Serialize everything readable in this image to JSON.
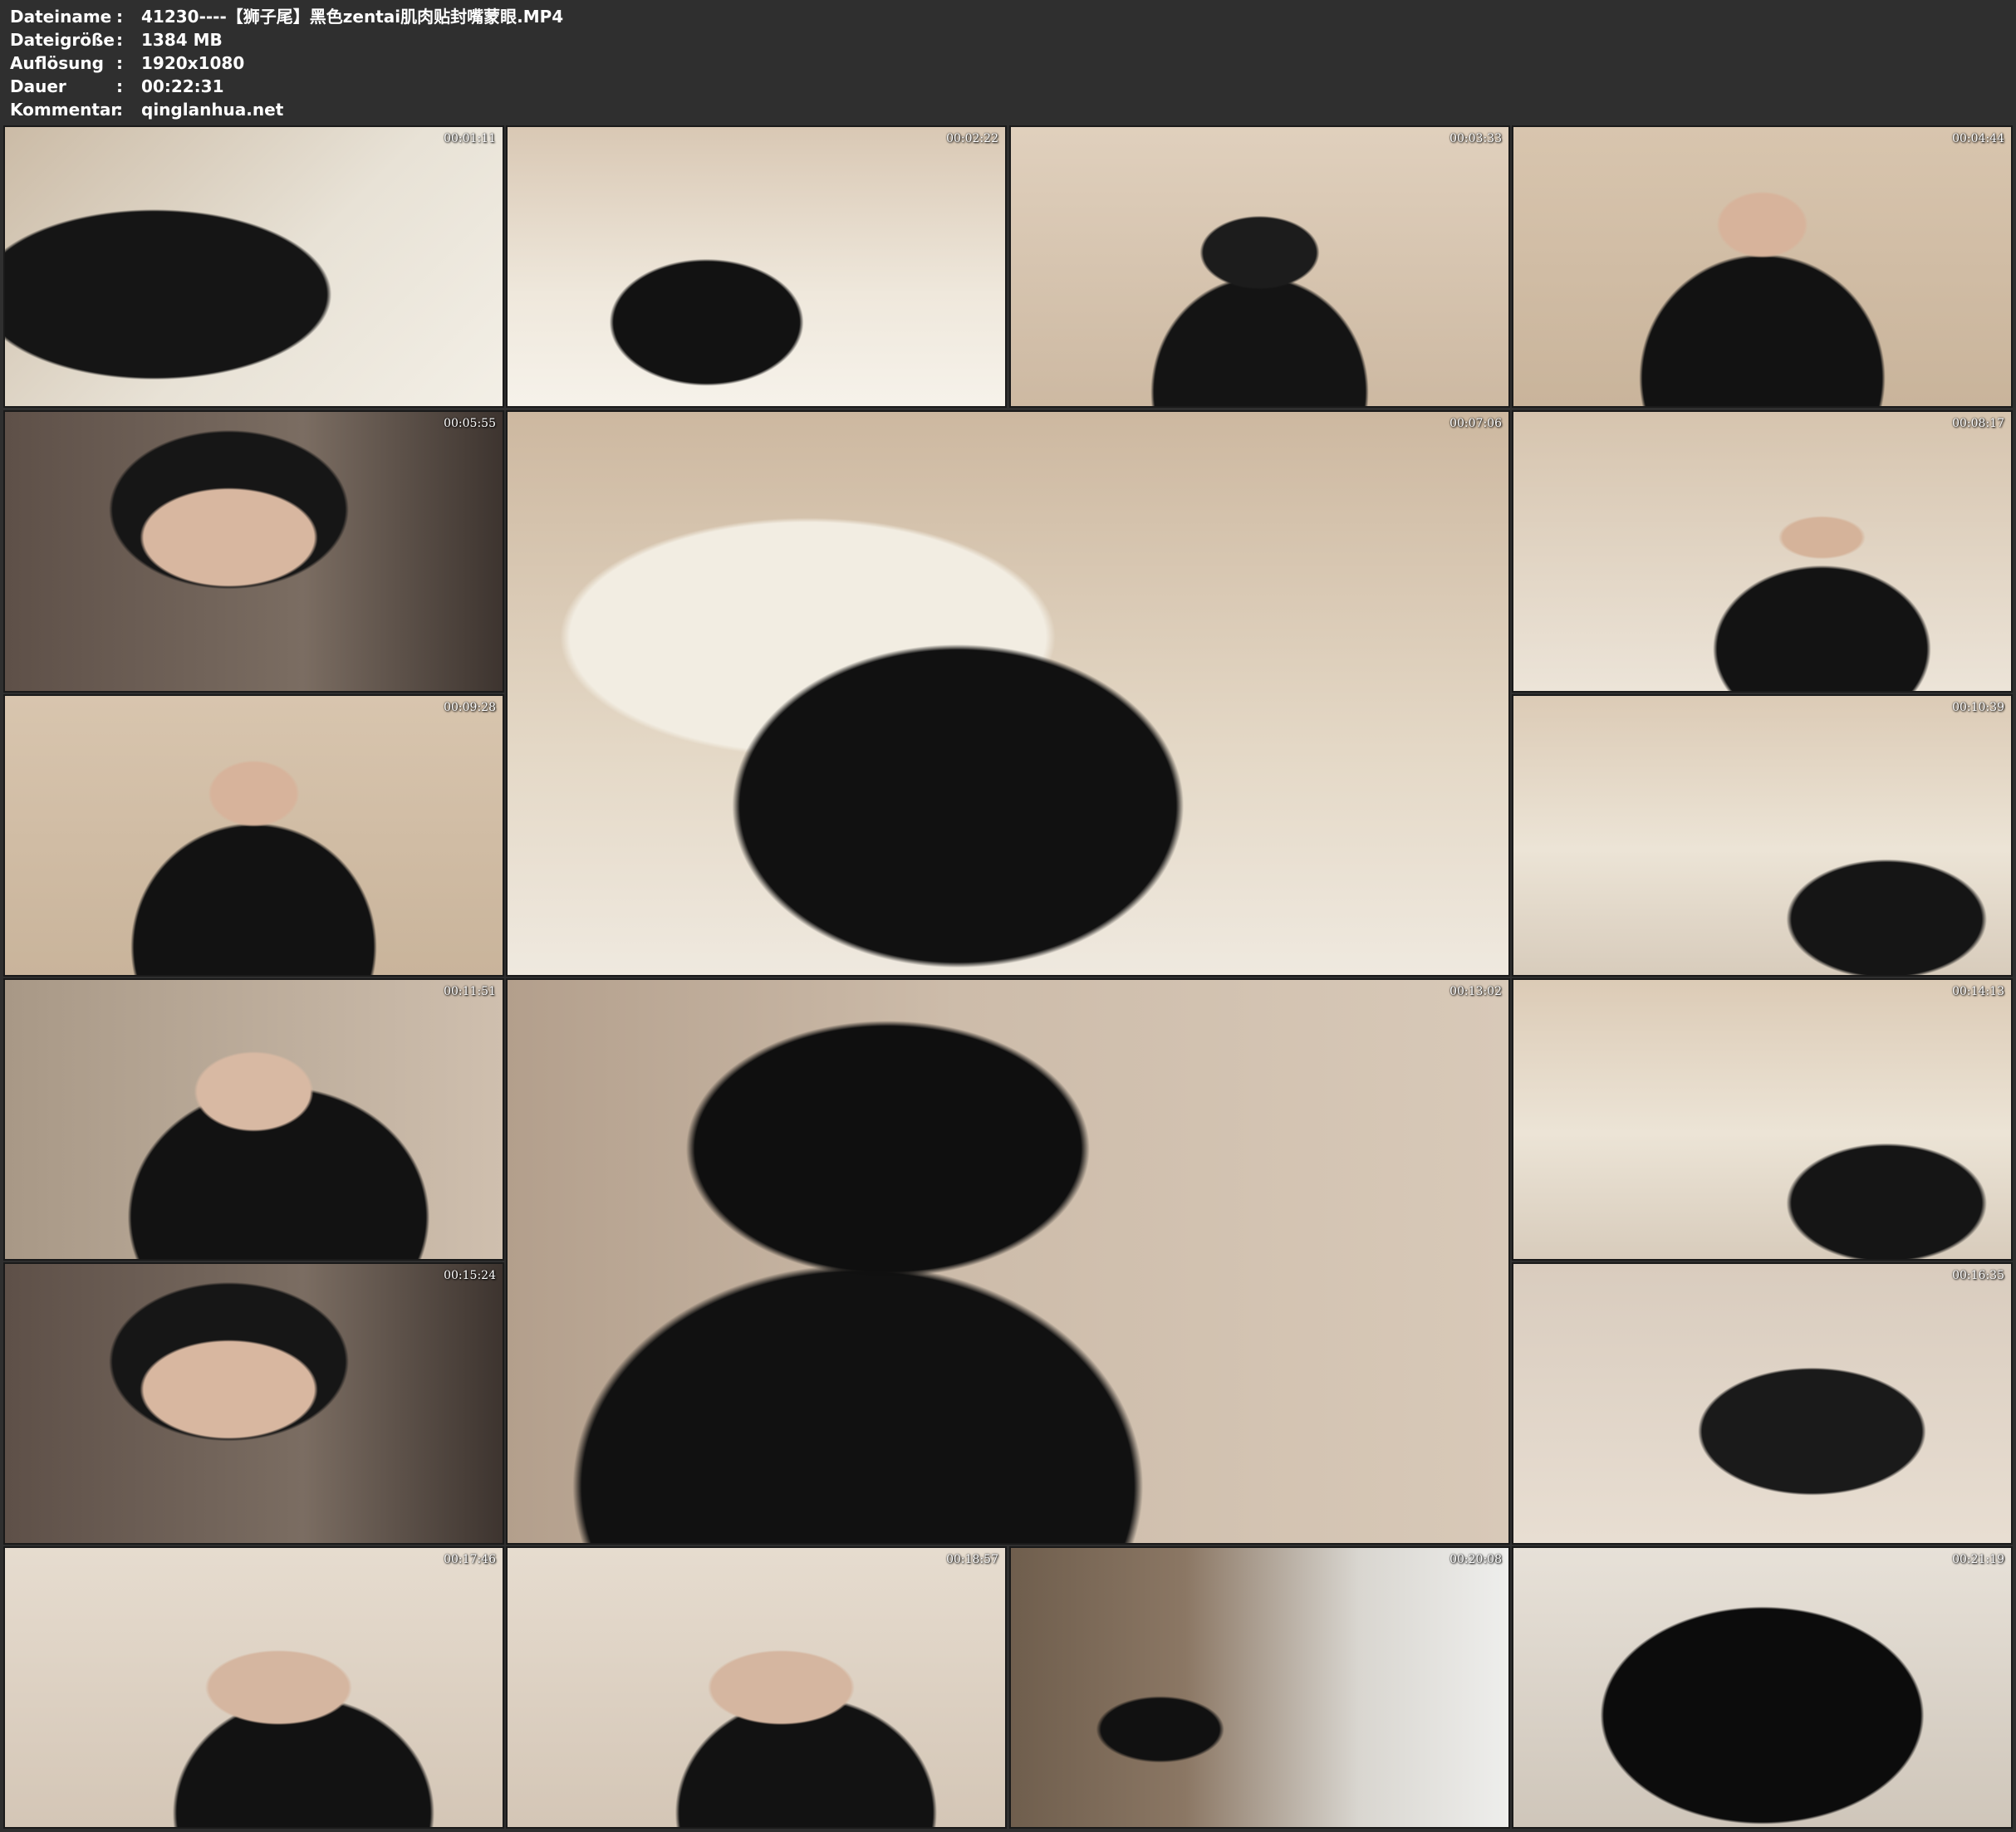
{
  "info": [
    {
      "key": "Dateiname",
      "value": "41230----【狮子尾】黑色zentai肌肉贴封嘴蒙眼.MP4"
    },
    {
      "key": "Dateigröße",
      "value": "1384 MB"
    },
    {
      "key": "Auflösung",
      "value": "1920x1080"
    },
    {
      "key": "Dauer",
      "value": "00:22:31"
    },
    {
      "key": "Kommentar",
      "value": "qinglanhua.net"
    }
  ],
  "separator": ":",
  "thumbnails": [
    {
      "time": "00:01:11",
      "scene": "kneel"
    },
    {
      "time": "00:02:22",
      "scene": "back"
    },
    {
      "time": "00:03:33",
      "scene": "face-low"
    },
    {
      "time": "00:04:44",
      "scene": "face-center"
    },
    {
      "time": "00:05:55",
      "scene": "face-close"
    },
    {
      "time": "00:07:06",
      "scene": "sofa-large"
    },
    {
      "time": "00:08:17",
      "scene": "room-face"
    },
    {
      "time": "00:09:28",
      "scene": "face-center"
    },
    {
      "time": "00:10:39",
      "scene": "room-wide"
    },
    {
      "time": "00:11:51",
      "scene": "face-down"
    },
    {
      "time": "00:13:02",
      "scene": "hair-large"
    },
    {
      "time": "00:14:13",
      "scene": "room-wide"
    },
    {
      "time": "00:15:24",
      "scene": "face-close"
    },
    {
      "time": "00:16:35",
      "scene": "blur"
    },
    {
      "time": "00:17:46",
      "scene": "face-side"
    },
    {
      "time": "00:18:57",
      "scene": "face-side"
    },
    {
      "time": "00:20:08",
      "scene": "standing"
    },
    {
      "time": "00:21:19",
      "scene": "closeup-black"
    }
  ]
}
